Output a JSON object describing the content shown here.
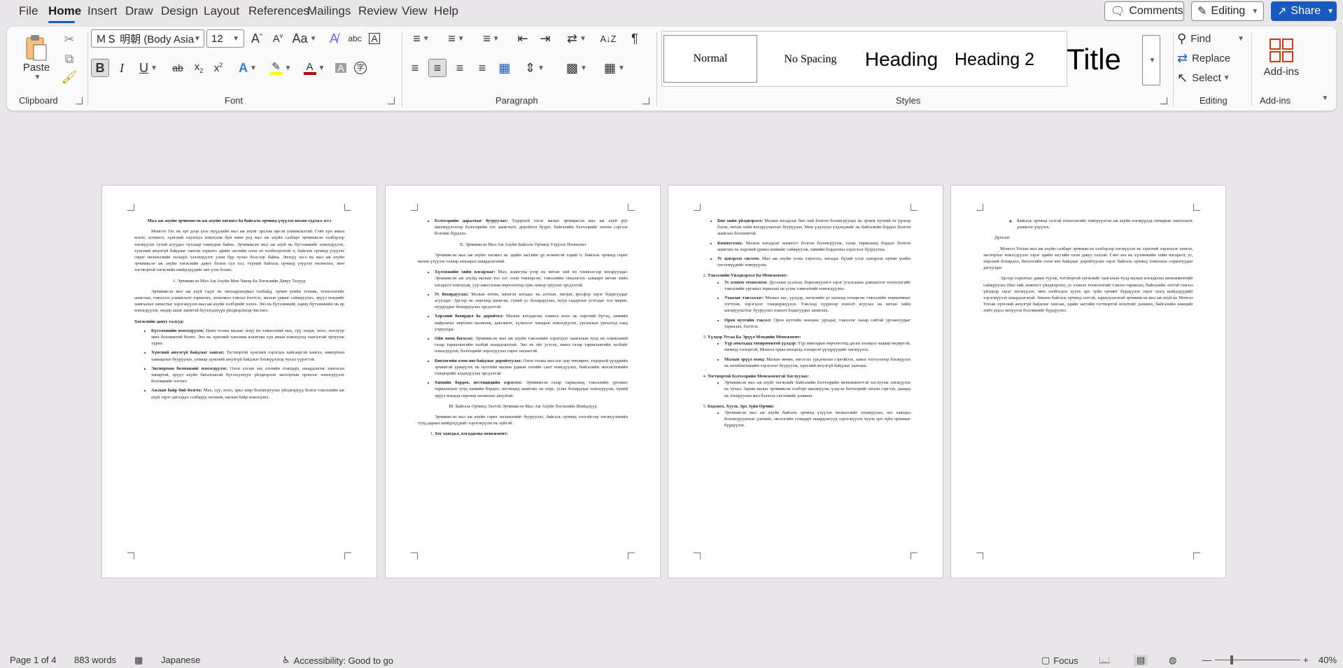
{
  "menu": {
    "tabs": [
      "File",
      "Home",
      "Insert",
      "Draw",
      "Design",
      "Layout",
      "References",
      "Mailings",
      "Review",
      "View",
      "Help"
    ],
    "active_tab": "Home",
    "comments_label": "Comments",
    "editing_label": "Editing",
    "share_label": "Share"
  },
  "ribbon": {
    "clipboard": {
      "paste_label": "Paste",
      "group_label": "Clipboard"
    },
    "font": {
      "font_name": "ＭＳ 明朝 (Body Asia",
      "font_size": "12",
      "group_label": "Font",
      "highlight_color": "#ffff00",
      "font_color": "#c00000"
    },
    "paragraph": {
      "group_label": "Paragraph"
    },
    "styles": {
      "items": [
        "Normal",
        "No Spacing",
        "Heading",
        "Heading 2",
        "Title"
      ],
      "group_label": "Styles"
    },
    "editing": {
      "find_label": "Find",
      "replace_label": "Replace",
      "select_label": "Select",
      "group_label": "Editing"
    },
    "addins": {
      "label": "Add-ins",
      "group_label": "Add-ins"
    }
  },
  "document": {
    "page1": {
      "title": "Мал аж ахуйн эрчимжсэн аж ахуйн хөгжил ба байгаль орчинд үзүүлэх нөлөө судлал эссэ",
      "intro": "Монгол Улс нь эрт дээр үеэс нүүдлийн мал аж ахуйг эрхлэж ирсэн уламжлалтай. Гэвч хүн амын өсөлт, хотжилт, хүнсний хэрэгцээ нэмэгдэж буй өнөө үед мал аж ахуйн салбарт эрчимжсэн хэлбэрээр хөгжүүлэх тухай асуудал чухлаар тавигдаж байна. Эрчимжсэн мал аж ахуй нь бүтээмжийг нэмэгдүүлэх, хүнсний аюулгүй байдлыг хангах зорилго эдийн засгийн олон ач холбогдолтой ч, байгаль орчинд үзүүлэх сөрөг нөлөөллийн талаарх хэлэлцүүлэг улам бүр чухал болсоор байна. Энэхүү эссэ нь мал аж ахуйн эрчимжсэн аж ахуйн хөгжлийн давуу болон сул тал, түүний байгаль орчинд үзүүлэх нөлөөлөл, мөн тогтвортой хөгжлийн шийдлүүдийг авч үзэх болно.",
      "section1": "I. Эрчимжсэн Мал Аж Ахуйн Мөн Чанар Ба Хөгжлийн Давуу Талууд",
      "para2": "Эрчимжсэн мал аж ахуй гэдэг нь хязгаарлагдмал талбайд, орчин үеийн техник, технологийг ашиглан, тэжээлээ уламжлалт тариалах, зохиомол тэжээл бэлтгэх, малын удмыг сайжруулах, эрүүл мэндийг хамгаалах хяналтыг хэрэгжүүлэх мал аж ахуйн хэлбэрийг хэлнэ. Энэ нь бүтээмжийг, хариу бүтээмжийн нь өр нэмэгдүүлэх, өндөр ашиг шимтэй бүтээгдэхүүн үйлдвэрлэхэд чиглэнэ.",
      "adv_heading": "Хөгжлийн давуу талууд:",
      "adv_items": [
        {
          "bold": "Бүтээмжийн нэмэгдүүлэх:",
          "text": "Цөөн тооны малаас илүү их хэмжээний мах, сүү, өндөг, ноос, ноолуур авах боломжтой болно. Энэ нь хүнсний хангамж ялангуяа хүн амын нэмэгдэлд хангалтай орчуулж хүрнэ."
        },
        {
          "bold": "Хүнсний аюулгүй байдлыг хангах:",
          "text": "Тогтвортой хүнсний хэрэгцээ хайгааргэй хангах, импортын хамаарлыг бууруулах, улмаар хүнсний аюулгүй байдлыг бэхжүүлэхэд чухал үүрэгтэй."
        },
        {
          "bold": "Экспортын боломжийг нэмэгдүүлэх:",
          "text": "Олон улсын зах зээлийн стандарт, шаардлагыг хангасан чанартай, эрүүл ахуйн баталгаатай бүтээгдэхүүн үйлдвэрлэн экспортын орлогыг нэмэгдүүлэх боломжийг олгоно."
        },
        {
          "bold": "Ажлын байр бий болгох:",
          "text": "Мах, сүү, ноос, арьс шир боловсруулах үйлдвэрүүд болон тэжээлийн аж ахуй зэрэг дагалдах салбаруд хөгжиж, ажлын байр нэмэгдэнэ."
        }
      ]
    },
    "page2": {
      "top_items": [
        {
          "bold": "Бэлчээрийн даралтыг бууруулах:",
          "text": "Тодорхой хэсэг малыг эрчимжсэн мал аж ахуй руу шилжүүлснээр бэлчээрийн хэт ашиглалт, доройтол буурч, байгалийн бэлчээрийг нөхөн сэргээх боломж бүрдэнэ."
        }
      ],
      "section2": "II. Эрчимжсэн Мал Аж Ахуйн Байгаль Орчинд Үзүүлэх Нөлөөлөл",
      "para": "Эрчимжсэн мал аж ахуйн хөгжил нь эдийн засгийн үр өгөөжтэй хэдий ч, байгаль орчинд сөрөг нөлөө үзүүлэх талаар анхаарах шаардлагатай.",
      "impact_items": [
        {
          "bold": "Хүлэмжийн хийн ялгарлыг:",
          "text": "Мал, ялангуяа үхэр нь метан хий их хэмжээгээр ялгаруулдаг. Эрчимжсэн аж ахуйд малын тоо хэт олон төвлөрсөн, тэжээлийн онцлогоос хамаарч метан хийн ялгаралт нэмэгдэж, уур амьсгалын өөрчлөлтөд хувь нэмэр оруулах эрсдэлтэй."
        },
        {
          "bold": "Ус бохирдуулах:",
          "text": "Малын өтгөн, шингэн ялгадас нь азотын, нитрат, фосфор зэрэг бодисуудыг агуулдаг. Эдгээр нь хөрсөнд шингэж, гүний ус бохирдуулах, нуур гадаргын устгадаг гол мөрөн, нууруудыг бохирдуулах эрсдэлтэй."
        },
        {
          "bold": "Хөрсний бохирдол ба доройтол:",
          "text": "Малын ялгадасны хэмжээ өсөх нь хөрсний бүтэц, химийн найрлагыг өөрчлөн нөлөөлж, давсжилт, хүчиллэг чанарыг нэмэгдүүлэх, ургамлын ургалтад саад учруулдаг."
        },
        {
          "bold": "Ойн нөөц багасах:",
          "text": "Эрчимжсэн мал аж ахуйн тэжээлийн хэрэгцээг хангахын тулд их хэмжээний газар тариалангийн талбай шаардлагатай. Энэ нь ойг устгах, шинэ газар тариалангийн талбайг нэмэгдүүлэх, бэлчээрийг хорогдуулах сөрөг нөлөөтэй."
        },
        {
          "bold": "Биологийн олон янз байдлыг доройтуулах:",
          "text": "Олон тооны мал нэг дор төвлөрөх, тодорхой үүлдрийн эрчимтэй үржүүлэх нь нутгийн малын удмын генийн сант хомсдуулах, байгалийн экосистемийн тэнцвэрийг алдагдуулах эрсдэлтэй."
        },
        {
          "bold": "Химийн бордоо, пестицидийн хэрэглээ:",
          "text": "Эрчимжсэн газар тариаланд тэжээлийн ургамал тариалахын тулд химийн бордоо, пестицид ашиглах нь хөрс, усны бохирдлыг нэмэгдүүлж, хүний эрүүл мэндэд сөргөөр нөлөөлөх аюултай."
        }
      ],
      "section3": "III. Байгаль Орчинд Ээлтэй Эрчимжсэн Мал Аж Ахуйн Хөгжлийн Шийдлүүд",
      "para3": "Эрчимжсэн мал аж ахуйн сөрөг нөлөөллийг бууруулах, байгаль орчинд ээлтэйгээр хөгжүүлэхийн тулд дараах шийдлүүдийг хэрэгжүүлэх нь зүйтэй.",
      "sol_first": "Хог хаягдал, ялгадасны менежмент:"
    },
    "page3": {
      "sub_items1": [
        {
          "bold": "Био хийн үйлдвэрлэл:",
          "text": "Малын ялгадсыг био хий болгон боловсруулах нь эрчим хүчний эх үүсвэр бэлэх, метан хийн ялгаруулалтыг бууруулах. Мөн үлдэгдэл үлдэгдлийг нь байгалийн бордоо болгон ашиглах боломжтой."
        },
        {
          "bold": "Компостлох:",
          "text": "Малын ялгадсыг компост болгон боловсруулж, газар тариаланд бордоо болгон ашиглах нь хөрсний үржил шимийг сайжруулж, химийн бордооны хэрэглээг бууруулна."
        },
        {
          "bold": "Ус цэвэрлэх систем:",
          "text": "Мал аж ахуйн усны хэрэглээ, ялгадас бүхий усыг цэвэрлэх орчин үеийн системүүдийг нэвтрүүлэх."
        }
      ],
      "item2": "Тэжээлийн Үйлдвэрлэл Ба Менежмент:",
      "sub_items2": [
        {
          "bold": "Ус хэмнэх технологи:",
          "text": "Дусалын усалгаа, бороожуулагч зэрэг усалгааны дэвшилтэт технологийг тэжээлийн ургамал тариалах нь усны хэмнэлтийг нэмэгдүүлнэ."
        },
        {
          "bold": "Ухаалаг тэжээллэг:",
          "text": "Малын нас, үүлдэр, хөгжлийн үе шатанд тохирсон тэжээлийн нормативыг тогтоож, хэрэгцээг тэнцвэржүүлэх. Тэжээлд хүүрнээр нэмэлт агуулах нь метан хийн ялгаруулалтыг бууруулах нэмэлт бодисуудыг ашиглах."
        },
        {
          "bold": "Орон нутгийн тэжээл:",
          "text": "Орон нутгийн нөөцөөс ургадаг, тэжээлэг чанар сайтай ургамлуудыг тариалах, бэлтгэх."
        }
      ],
      "item3": "Үүлдэр Угсаа Ба Эрүүл Мэндийн Менежмент:",
      "sub_items3": [
        {
          "bold": "Үүр амьтадад тохиромжтой үүлдэр:",
          "text": "Үүр амьтадын өөрчлөлтөд дасан зохицох чадвар өндөртэй, өвчинд тэсвэртэй, Монгол орны нөхцөлд тохирсон үүлдрүүдийг хөгжүүлэх."
        },
        {
          "bold": "Малын эрүүл мэнд:",
          "text": "Малын өвчин, эмгэгээс урьдчилан сэргийлэх, хавьх тогтоолоор бэхжүүлэх нь антибиотикийн хэрэглээг бууруулж, хүнсний аюулгүй байдлыг хангана."
        }
      ],
      "item4": "Тогтвортой Бэлчээрийн Менежментэй Хослуулах:",
      "sub_items4": [
        {
          "bold": "",
          "text": "Эрчимжсэн мал аж ахуйг хөгжлийг байгалийн бэлчээрийн менежменттэй хослуулж хөгжүүлэх нь чухал. Зарим малыг эрчимжсэн хэлбэрт шилжүүлж, үлдсэн бэлчээрийг нөхөн сэргээх, даацад нь тохируулан мал бэлчээх системийг дэмжих."
        }
      ],
      "item5": "Бодлого, Хууль Эрх Зүйн Орчин:",
      "sub_items5": [
        {
          "bold": "",
          "text": "Эрчимжсэн мал аж ахуйн байгаль орчинд үзүүлэх нөлөөллийг зохицуулах, хог хаягдал боловсруулахыг дэмжих, экологийн стандарт шаардлагууд хэрэгжүүлэх хууль эрх зүйн орчиныг бүрдүүлэх."
        }
      ]
    },
    "page4": {
      "top_sub": "Байгаль орчинд ээлтэй технологийг нэвтрүүлсэн аж ахуйн нэгжүүдэд татварын хөнгөлөлт, дэмжлэг үзүүлэх.",
      "conclusion_label": "Дүгнэлт",
      "para1": "Монгол Улсын мал аж ахуйн салбарт эрчимжсэн хэлбэрээр хөгжүүлэх нь хүнсний хэрэгцээг хангах, экспортыг нэмэгдүүлэх зэрэг эдийн засгийн олон давуу талтай. Гэвч энэ нь хүлэмжийн хийн ялгаралт, ус, хөрсний бохирдол, биологийн олон янз байдлыг доройтуулах зэрэг байгаль орчинд томоохон сорилтуудыг дагуулдаг.",
      "para2": "Эдгээр сорилтыг даван туулж, тогтвортой хөгжлийг хангахын тулд малын ялгадасны менежментийг сайжруулах (био хий, компост үйлдвэрлэх), ус хэмнэх технологийг тэжээл тариалах, байгалийн ээлтэй тэжээл үйлдвэр зэрэг хөгжүүлэх, мөн холбогдох хууль эрх зүйн орчинг бүрдүүлэх зэрэг цогц шийдлүүдийг хэрэгжүүлэх шаардлагатай. Зөвхөн байгаль орчинд ээлтэй, хариуцлагатай эрчимжсэн мал аж ахуй нь Монгол Улсын хүнсний аюулгүй байдлыг хангаж, эдийн засгийн тогтвортой өсөлтийг дэмжих, байгалийн нөөцийг хойч үедээ өвлүүлэх боломжийг бүрдүүлнэ."
    }
  },
  "status": {
    "page": "Page 1 of 4",
    "words": "883 words",
    "language": "Japanese",
    "accessibility": "Accessibility: Good to go",
    "focus": "Focus",
    "zoom": "40%"
  }
}
